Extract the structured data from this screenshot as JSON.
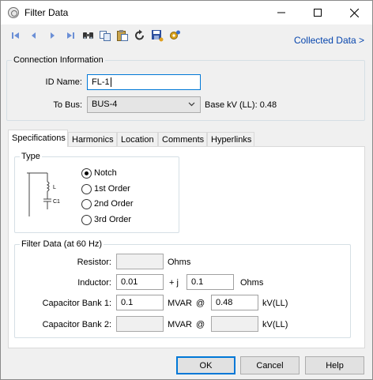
{
  "window": {
    "title": "Filter Data"
  },
  "toolbar": {
    "buttons": [
      "first-icon",
      "previous-icon",
      "next-icon",
      "last-icon",
      "find-icon",
      "copy-icon",
      "paste-icon",
      "undo-icon",
      "save-icon",
      "settings-icon"
    ],
    "collected_link": "Collected Data >"
  },
  "connection": {
    "legend": "Connection Information",
    "id_label": "ID Name:",
    "id_value": "FL-1",
    "bus_label": "To Bus:",
    "bus_value": "BUS-4",
    "basekv_text": "Base kV (LL): 0.48"
  },
  "tabs": [
    "Specifications",
    "Harmonics",
    "Location",
    "Comments",
    "Hyperlinks"
  ],
  "active_tab": "Specifications",
  "type_group": {
    "legend": "Type",
    "schematic_labels": {
      "inductor": "L",
      "capacitor": "C1"
    },
    "options": [
      "Notch",
      "1st Order",
      "2nd Order",
      "3rd Order"
    ],
    "selected": "Notch"
  },
  "filter_data": {
    "legend": "Filter Data (at 60 Hz)",
    "resistor": {
      "label": "Resistor:",
      "value": "",
      "unit": "Ohms"
    },
    "inductor": {
      "label": "Inductor:",
      "value": "0.01",
      "plus_j": "+ j",
      "value2": "0.1",
      "unit": "Ohms"
    },
    "cap1": {
      "label": "Capacitor Bank 1:",
      "value": "0.1",
      "unit": "MVAR",
      "at": "@",
      "kv": "0.48",
      "kv_unit": "kV(LL)"
    },
    "cap2": {
      "label": "Capacitor Bank 2:",
      "value": "",
      "unit": "MVAR",
      "at": "@",
      "kv": "",
      "kv_unit": "kV(LL)"
    }
  },
  "buttons": {
    "ok": "OK",
    "cancel": "Cancel",
    "help": "Help"
  },
  "colors": {
    "link": "#0645ad",
    "focus": "#0078d7",
    "nav_icons": "#6b8fd6"
  }
}
